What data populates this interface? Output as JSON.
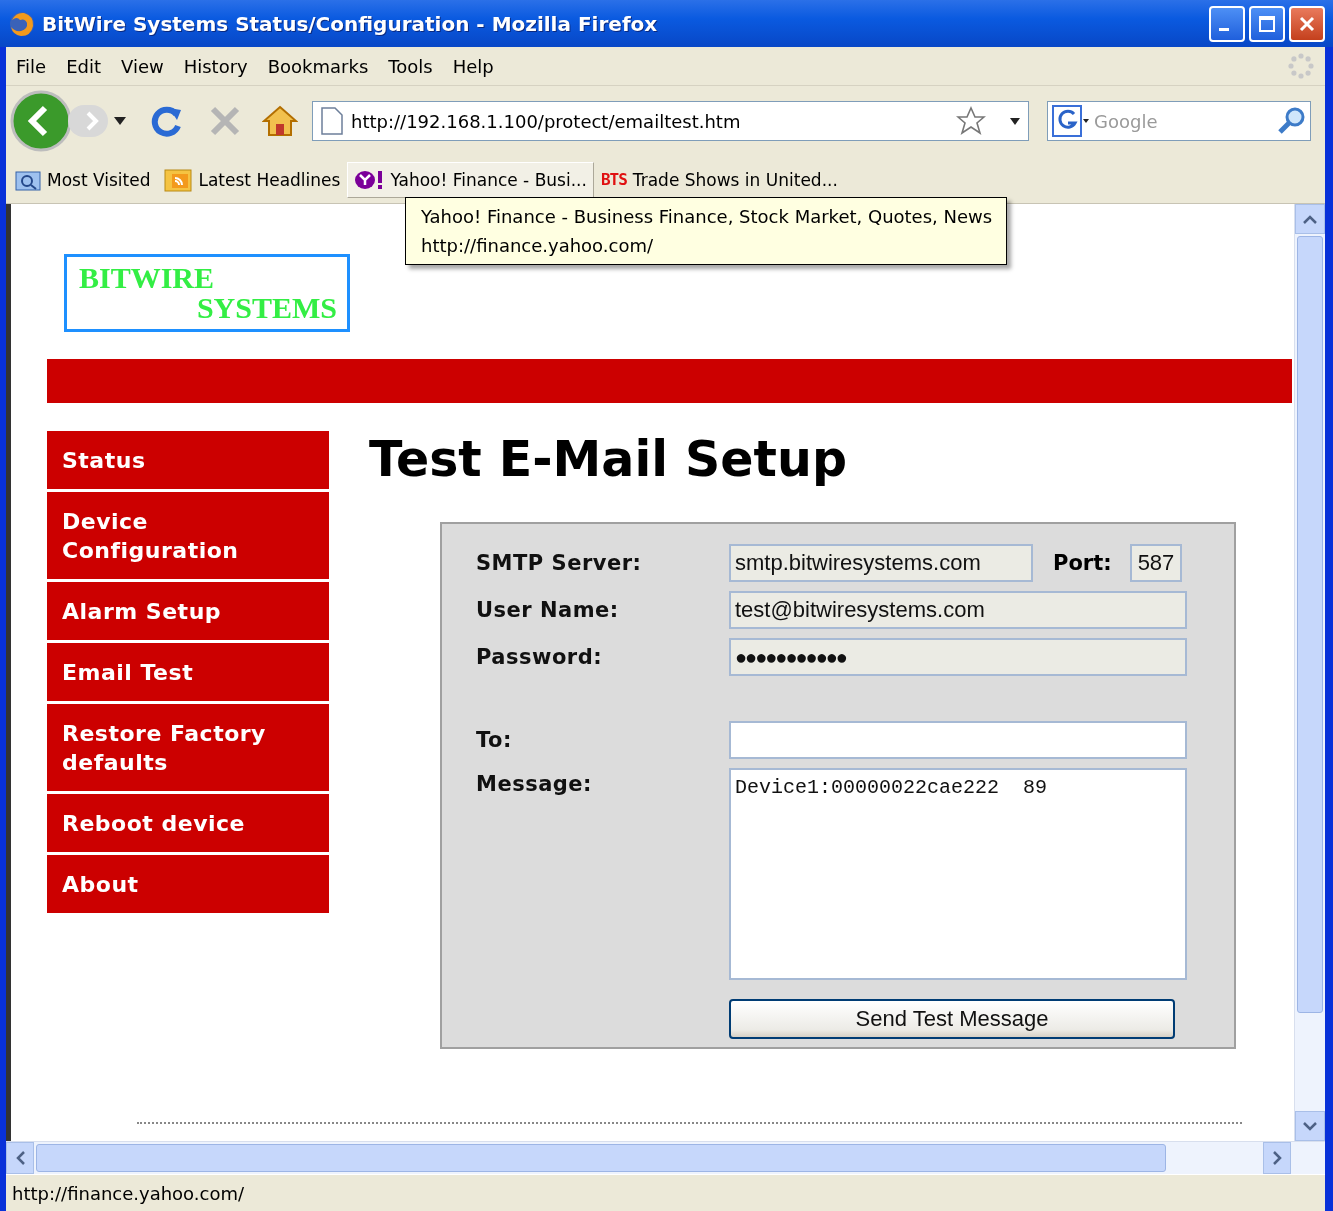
{
  "window": {
    "title": "BitWire Systems Status/Configuration - Mozilla Firefox"
  },
  "menu": [
    {
      "label": "File"
    },
    {
      "label": "Edit"
    },
    {
      "label": "View"
    },
    {
      "label": "History"
    },
    {
      "label": "Bookmarks"
    },
    {
      "label": "Tools"
    },
    {
      "label": "Help"
    }
  ],
  "address_bar": {
    "value": "http://192.168.1.100/protect/emailtest.htm"
  },
  "search": {
    "placeholder": "Google"
  },
  "bookmarks": [
    {
      "label": "Most Visited",
      "kind": "folder",
      "hovered": false
    },
    {
      "label": "Latest Headlines",
      "kind": "feed",
      "hovered": false
    },
    {
      "label": "Yahoo! Finance - Busi...",
      "kind": "yahoo",
      "hovered": true
    },
    {
      "label": "Trade Shows in United...",
      "kind": "bts",
      "icon_text": "BTS",
      "hovered": false
    }
  ],
  "tooltip": {
    "lines": [
      "Yahoo! Finance - Business Finance, Stock Market, Quotes, News",
      "http://finance.yahoo.com/"
    ]
  },
  "logo": {
    "lines": [
      "BITWIRE",
      "SYSTEMS"
    ]
  },
  "nav": [
    {
      "label": "Status"
    },
    {
      "label": "Device Configuration"
    },
    {
      "label": "Alarm Setup"
    },
    {
      "label": "Email Test"
    },
    {
      "label": "Restore Factory defaults"
    },
    {
      "label": "Reboot device"
    },
    {
      "label": "About"
    }
  ],
  "heading": "Test E-Mail Setup",
  "form": {
    "smtp_server": {
      "label": "SMTP Server:",
      "value": "smtp.bitwiresystems.com"
    },
    "port": {
      "label": "Port:",
      "value": "587"
    },
    "user_name": {
      "label": "User Name:",
      "value": "test@bitwiresystems.com"
    },
    "password": {
      "label": "Password:",
      "value": "●●●●●●●●●●●"
    },
    "to": {
      "label": "To:"
    },
    "message": {
      "label": "Message:",
      "value": "Device1:00000022cae222  89"
    },
    "button": "Send Test Message"
  },
  "status_bar": {
    "text": "http://finance.yahoo.com/"
  }
}
